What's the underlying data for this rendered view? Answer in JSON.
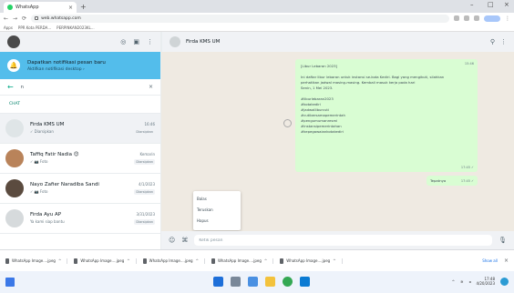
{
  "browser": {
    "tab_title": "WhatsApp",
    "url": "web.whatsapp.com",
    "bookmarks": [
      "Apps",
      "PPR Kota PERDA...",
      "PERPINKAN2023KL..."
    ]
  },
  "left": {
    "notification": {
      "title": "Dapatkan notifikasi pesan baru",
      "subtitle": "Aktifkan notifikasi desktop ›"
    },
    "search": {
      "query": "n"
    },
    "section_label": "CHAT",
    "chats": [
      {
        "name": "Firda KMS UM",
        "time": "16:46",
        "last": "✓ Diarsipkan",
        "badge": "Diarsipkan"
      },
      {
        "name": "Taffiq Fatir Nadia 😊",
        "time": "Kemarin",
        "last": "✓ 📷 Foto",
        "badge": "Diarsipkan"
      },
      {
        "name": "Nayo Zafier Naradiba Sandi",
        "time": "4/1/2023",
        "last": "✓ 📷 Foto",
        "badge": "Diarsipkan"
      },
      {
        "name": "Firda Ayu AP",
        "time": "3/31/2023",
        "last": "Ya kami siap bantu",
        "badge": "Diarsipkan"
      }
    ]
  },
  "right": {
    "contact_name": "Firda KMS UM",
    "bubble": {
      "lines": [
        "[Libur Lebaran 2023]",
        "",
        "Ini daftar libur lebaran untuk instansi se-kota Kediri. Bagi yang mengikuti, silahkan",
        "perhatikan jadwal masing-masing. Kembali masuk kerja pada hari",
        "Senin, 1 Mei 2023.",
        "",
        "#liburlebaran2023",
        "#kotakediri",
        "#jadwalliburcuti",
        "#cutibersamapemerintah",
        "#pengumumanresmi",
        "#instansipemerintahan",
        "#kepegawaiankotakediri"
      ],
      "time_top": "15:46",
      "time": "17:45 ✓"
    },
    "small_bubble": {
      "text": "Tepatnya",
      "time": "17:45 ✓"
    },
    "context_menu": [
      {
        "label": "Balas",
        "shortcut": ""
      },
      {
        "label": "Teruskan",
        "shortcut": ""
      },
      {
        "label": "Hapus",
        "shortcut": ""
      }
    ],
    "composer": {
      "placeholder": "Ketik pesan"
    }
  },
  "downloads": {
    "items": [
      "WhatsApp Image....jpeg",
      "WhatsApp Image....jpeg",
      "WhatsApp Image....jpeg",
      "WhatsApp Image....jpeg",
      "WhatsApp Image....jpeg"
    ],
    "show_all": "Show all"
  },
  "taskbar": {
    "time": "17:48",
    "date": "4/20/2023"
  }
}
